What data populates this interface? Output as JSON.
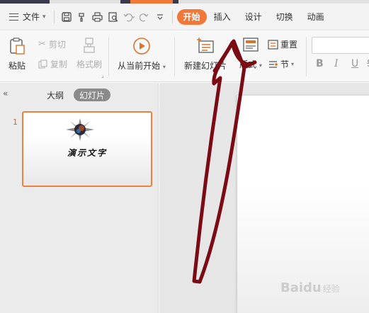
{
  "colors": {
    "accent": "#f07838",
    "arrow": "#7a0a14",
    "selection_border": "#f08040"
  },
  "menubar": {
    "file_label": "文件",
    "tabs": [
      {
        "label": "开始",
        "active": true
      },
      {
        "label": "插入",
        "active": false
      },
      {
        "label": "设计",
        "active": false
      },
      {
        "label": "切换",
        "active": false
      },
      {
        "label": "动画",
        "active": false
      }
    ],
    "quick_icons": [
      "save-icon",
      "format-painter-icon",
      "print-icon",
      "print-preview-icon",
      "undo-icon",
      "redo-icon",
      "customize-icon"
    ]
  },
  "ribbon": {
    "paste_label": "粘贴",
    "cut_label": "剪切",
    "copy_label": "复制",
    "format_painter_label": "格式刷",
    "play_from_current_label": "从当前开始",
    "new_slide_label": "新建幻灯片",
    "layout_label": "版式",
    "reset_label": "重置",
    "section_label": "节",
    "bold_label": "B",
    "italic_label": "I",
    "underline_label": "U",
    "strike_label": "S"
  },
  "left_panel": {
    "tabs": [
      {
        "label": "大纲",
        "active": false
      },
      {
        "label": "幻灯片",
        "active": true
      }
    ],
    "slides": [
      {
        "number": "1",
        "title": "演示文字"
      }
    ]
  },
  "watermark": {
    "text": "Baidu",
    "sub": "经验"
  }
}
